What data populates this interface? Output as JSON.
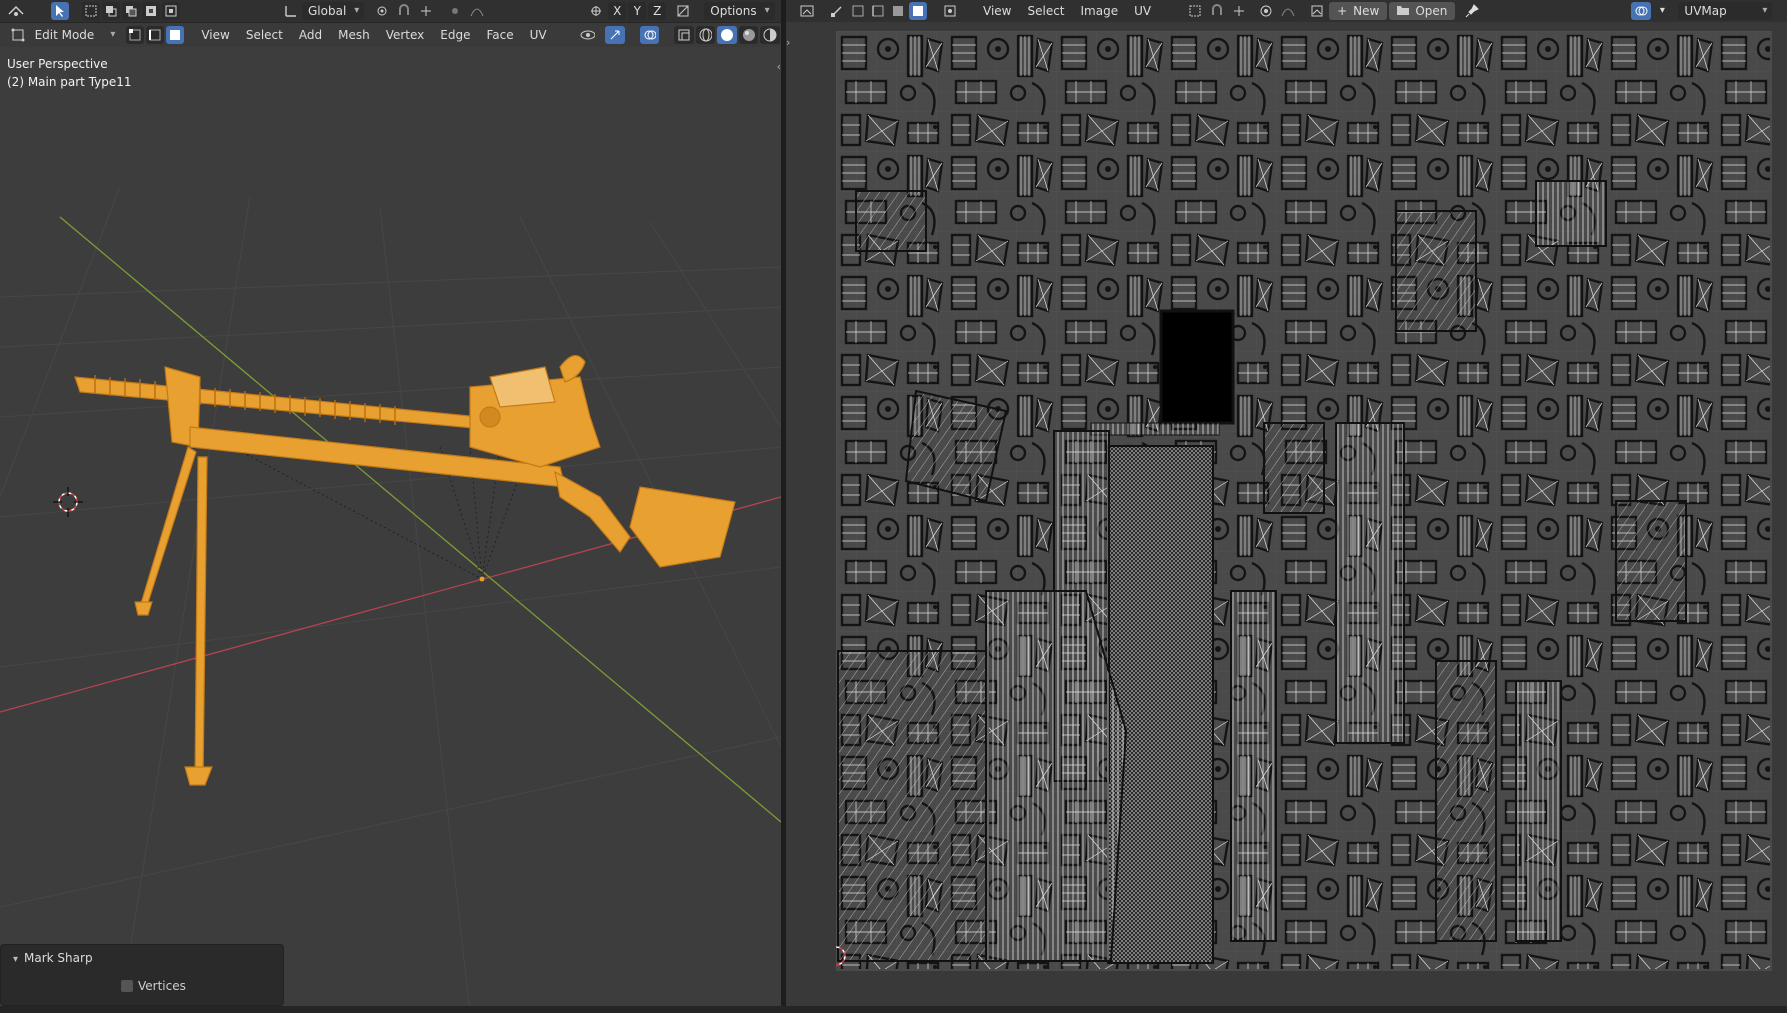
{
  "viewport": {
    "header_top": {
      "transform_orientation": "Global",
      "options_label": "Options",
      "axis_labels": [
        "X",
        "Y",
        "Z"
      ]
    },
    "header_mode": {
      "mode_label": "Edit Mode",
      "menus": [
        "View",
        "Select",
        "Add",
        "Mesh",
        "Vertex",
        "Edge",
        "Face",
        "UV"
      ]
    },
    "overlay": {
      "perspective": "User Perspective",
      "object": "(2) Main part Type11"
    },
    "operator_panel": {
      "title": "Mark Sharp",
      "option_label": "Vertices",
      "option_checked": false
    },
    "object_color": "#e8a030",
    "x_axis_color": "#b5444f",
    "y_axis_color": "#7a9e36"
  },
  "uv_editor": {
    "header": {
      "menus": [
        "View",
        "Select",
        "Image",
        "UV"
      ],
      "new_label": "New",
      "open_label": "Open",
      "uv_map": "UVMap"
    }
  }
}
